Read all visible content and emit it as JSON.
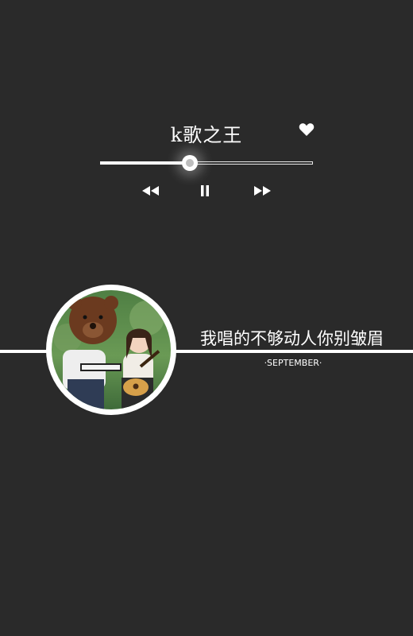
{
  "player": {
    "song_title": "k歌之王",
    "progress": 0.42,
    "liked": true
  },
  "controls": {
    "rewind_icon": "rewind-icon",
    "pause_icon": "pause-icon",
    "forward_icon": "fast-forward-icon"
  },
  "lyric_card": {
    "lyric": "我唱的不够动人你别皱眉",
    "subtitle": "·SEPTEMBER·"
  },
  "colors": {
    "background": "#2a2a2a",
    "foreground": "#ffffff"
  }
}
